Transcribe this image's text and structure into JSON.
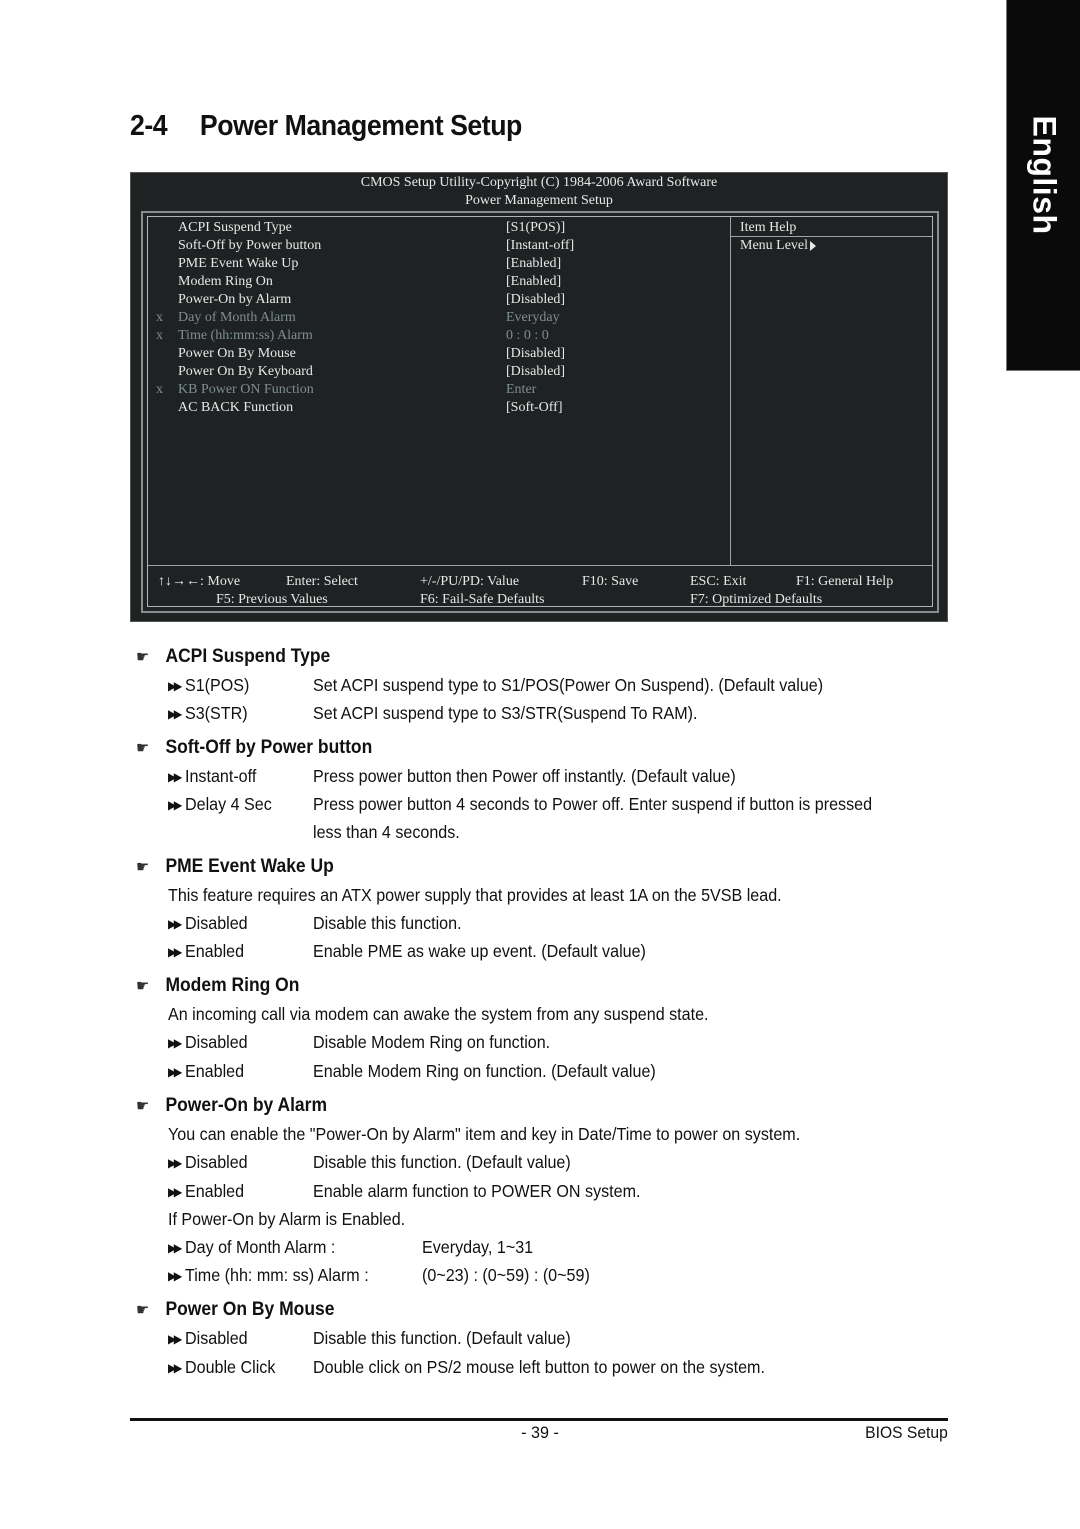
{
  "language_tab": "English",
  "page_title": {
    "number": "2-4",
    "text": "Power Management Setup"
  },
  "bios": {
    "header_line1": "CMOS Setup Utility-Copyright (C) 1984-2006 Award Software",
    "header_line2": "Power Management Setup",
    "items": [
      {
        "marker": "",
        "label": "ACPI Suspend Type",
        "value": "[S1(POS)]",
        "disabled": false
      },
      {
        "marker": "",
        "label": "Soft-Off by Power button",
        "value": "[Instant-off]",
        "disabled": false
      },
      {
        "marker": "",
        "label": "PME Event Wake Up",
        "value": "[Enabled]",
        "disabled": false
      },
      {
        "marker": "",
        "label": "Modem Ring On",
        "value": "[Enabled]",
        "disabled": false
      },
      {
        "marker": "",
        "label": "Power-On by Alarm",
        "value": "[Disabled]",
        "disabled": false
      },
      {
        "marker": "x",
        "label": "Day of Month Alarm",
        "value": "Everyday",
        "disabled": true
      },
      {
        "marker": "x",
        "label": "Time (hh:mm:ss) Alarm",
        "value": "0 : 0 : 0",
        "disabled": true
      },
      {
        "marker": "",
        "label": "Power On By Mouse",
        "value": "[Disabled]",
        "disabled": false
      },
      {
        "marker": "",
        "label": "Power On By Keyboard",
        "value": "[Disabled]",
        "disabled": false
      },
      {
        "marker": "x",
        "label": "KB Power ON Function",
        "value": "Enter",
        "disabled": true
      },
      {
        "marker": "",
        "label": "AC BACK Function",
        "value": "[Soft-Off]",
        "disabled": false
      }
    ],
    "help": {
      "title": "Item Help",
      "menu_level": "Menu Level"
    },
    "keys": {
      "move": "↑↓→←: Move",
      "select": "Enter: Select",
      "value": "+/-/PU/PD: Value",
      "save": "F10: Save",
      "exit": "ESC: Exit",
      "general_help": "F1: General Help",
      "previous": "F5: Previous Values",
      "failsafe": "F6: Fail-Safe Defaults",
      "optimized": "F7: Optimized Defaults"
    },
    "colors": {
      "background": "#1f2223",
      "text": "#e8e8e8",
      "disabled_text": "#7e8f8b"
    }
  },
  "sections": {
    "acpi": {
      "title": "ACPI Suspend Type",
      "options": [
        {
          "name": "S1(POS)",
          "desc": "Set ACPI suspend type to S1/POS(Power On Suspend). (Default value)"
        },
        {
          "name": "S3(STR)",
          "desc": "Set ACPI suspend type to S3/STR(Suspend To RAM)."
        }
      ]
    },
    "softoff": {
      "title": "Soft-Off by Power button",
      "options": [
        {
          "name": "Instant-off",
          "desc": "Press power button then Power off instantly. (Default value)"
        },
        {
          "name": "Delay 4 Sec",
          "desc": "Press power button 4 seconds to Power off. Enter suspend if button is pressed",
          "desc2": "less than 4 seconds."
        }
      ]
    },
    "pme": {
      "title": "PME Event Wake Up",
      "intro": "This feature requires an ATX power supply that provides at least 1A on the 5VSB lead.",
      "options": [
        {
          "name": "Disabled",
          "desc": "Disable this function."
        },
        {
          "name": "Enabled",
          "desc": "Enable PME as wake up event. (Default value)"
        }
      ]
    },
    "modem": {
      "title": "Modem Ring On",
      "intro": "An incoming call via modem can awake the system from any suspend state.",
      "options": [
        {
          "name": "Disabled",
          "desc": "Disable Modem Ring on function."
        },
        {
          "name": "Enabled",
          "desc": "Enable Modem Ring on function. (Default value)"
        }
      ]
    },
    "alarm": {
      "title": "Power-On by Alarm",
      "intro": "You can enable the \"Power-On by Alarm\" item and key in Date/Time to power on system.",
      "options": [
        {
          "name": "Disabled",
          "desc": "Disable this function. (Default value)"
        },
        {
          "name": "Enabled",
          "desc": "Enable alarm function to POWER ON system."
        }
      ],
      "if_enabled": "If Power-On by Alarm is Enabled.",
      "sub_options": [
        {
          "name": "Day of Month Alarm :",
          "desc": "Everyday, 1~31"
        },
        {
          "name": "Time (hh: mm: ss) Alarm :",
          "desc": "(0~23) : (0~59) : (0~59)"
        }
      ]
    },
    "mouse": {
      "title": "Power On By Mouse",
      "options": [
        {
          "name": "Disabled",
          "desc": "Disable this function. (Default value)"
        },
        {
          "name": "Double Click",
          "desc": "Double click on PS/2 mouse left button to power on the system."
        }
      ]
    }
  },
  "footer": {
    "page_number": "- 39 -",
    "section": "BIOS Setup"
  }
}
